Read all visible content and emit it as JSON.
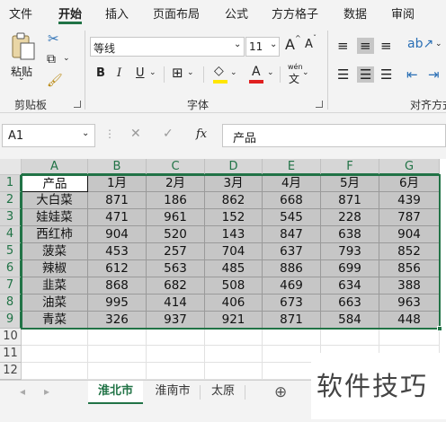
{
  "menu": {
    "tabs": [
      "文件",
      "开始",
      "插入",
      "页面布局",
      "公式",
      "方方格子",
      "数据",
      "审阅"
    ]
  },
  "ribbon": {
    "paste_label": "粘贴",
    "clipboard_group": "剪贴板",
    "font_name": "等线",
    "font_size": "11",
    "grow_font": "A",
    "shrink_font": "A",
    "bold": "B",
    "italic": "I",
    "underline": "U",
    "font_color_glyph": "A",
    "phonetic": "wén",
    "font_group": "字体",
    "align_group": "对齐方式"
  },
  "formula_bar": {
    "name_box": "A1",
    "fx": "fx",
    "content": "产品"
  },
  "sheet": {
    "columns": [
      "A",
      "B",
      "C",
      "D",
      "E",
      "F",
      "G"
    ],
    "rows": [
      "1",
      "2",
      "3",
      "4",
      "5",
      "6",
      "7",
      "8",
      "9",
      "10",
      "11",
      "12"
    ],
    "header": [
      "产品",
      "1月",
      "2月",
      "3月",
      "4月",
      "5月",
      "6月"
    ],
    "data": [
      [
        "大白菜",
        "871",
        "186",
        "862",
        "668",
        "871",
        "439"
      ],
      [
        "娃娃菜",
        "471",
        "961",
        "152",
        "545",
        "228",
        "787"
      ],
      [
        "西红柿",
        "904",
        "520",
        "143",
        "847",
        "638",
        "904"
      ],
      [
        "菠菜",
        "453",
        "257",
        "704",
        "637",
        "793",
        "852"
      ],
      [
        "辣椒",
        "612",
        "563",
        "485",
        "886",
        "699",
        "856"
      ],
      [
        "韭菜",
        "868",
        "682",
        "508",
        "469",
        "634",
        "388"
      ],
      [
        "油菜",
        "995",
        "414",
        "406",
        "673",
        "663",
        "963"
      ],
      [
        "青菜",
        "326",
        "937",
        "921",
        "871",
        "584",
        "448"
      ]
    ]
  },
  "tabs": {
    "sheets": [
      "淮北市",
      "淮南市",
      "太原"
    ],
    "add": "⊕"
  },
  "watermark": "软件技巧",
  "colors": {
    "accent": "#217346",
    "selection_fill": "#c6c6c6"
  }
}
